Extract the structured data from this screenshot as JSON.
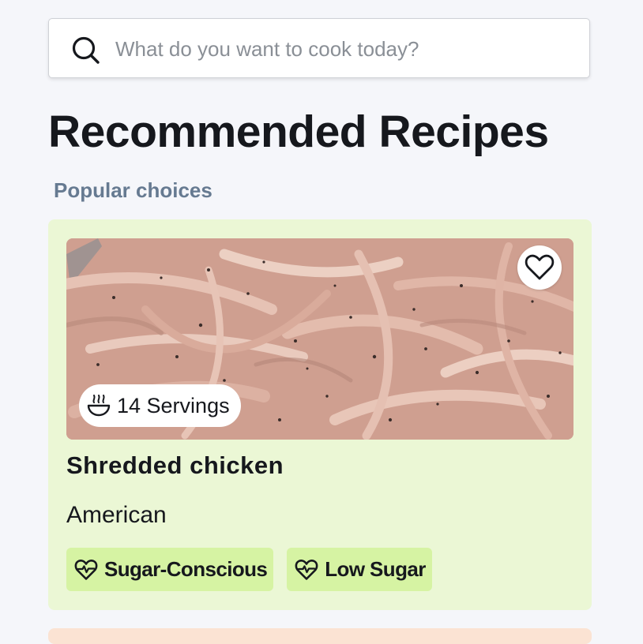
{
  "search": {
    "placeholder": "What do you want to cook today?",
    "value": ""
  },
  "page": {
    "title": "Recommended Recipes",
    "subtitle": "Popular choices"
  },
  "card": {
    "servings_label": "14 Servings",
    "title": "Shredded chicken",
    "cuisine": "American",
    "tags": [
      {
        "label": "Sugar-Conscious",
        "icon": "heart-pulse-icon"
      },
      {
        "label": "Low Sugar",
        "icon": "heart-pulse-icon"
      }
    ],
    "favorite_icon": "heart-outline-icon",
    "servings_icon": "bowl-steam-icon",
    "colors": {
      "card_bg": "#ebf7d5",
      "tag_bg": "#d6f3a3",
      "subtitle": "#667a91"
    }
  }
}
